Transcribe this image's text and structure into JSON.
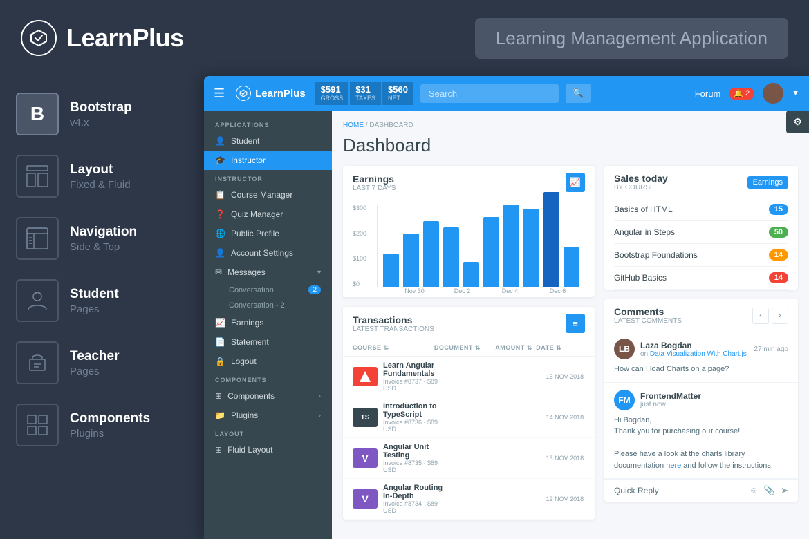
{
  "header": {
    "logo_text": "LearnPlus",
    "app_title": "Learning Management Application"
  },
  "left_sidebar": {
    "items": [
      {
        "id": "bootstrap",
        "main": "Bootstrap",
        "sub": "v4.x",
        "icon_type": "b"
      },
      {
        "id": "layout",
        "main": "Layout",
        "sub": "Fixed & Fluid",
        "icon_type": "layout"
      },
      {
        "id": "navigation",
        "main": "Navigation",
        "sub": "Side & Top",
        "icon_type": "nav"
      },
      {
        "id": "student",
        "main": "Student",
        "sub": "Pages",
        "icon_type": "student"
      },
      {
        "id": "teacher",
        "main": "Teacher",
        "sub": "Pages",
        "icon_type": "teacher"
      },
      {
        "id": "components",
        "main": "Components",
        "sub": "Plugins",
        "icon_type": "components"
      }
    ]
  },
  "inner_nav": {
    "logo": "LearnPlus",
    "stats": [
      {
        "value": "$591",
        "label": "GROSS"
      },
      {
        "value": "$31",
        "label": "TAXES"
      },
      {
        "value": "$560",
        "label": "NET"
      }
    ],
    "search_placeholder": "Search",
    "forum_label": "Forum",
    "notif_count": "2"
  },
  "inner_sidebar": {
    "sections": [
      {
        "label": "APPLICATIONS",
        "items": [
          {
            "label": "Student",
            "icon": "👤",
            "active": false
          },
          {
            "label": "Instructor",
            "icon": "🎓",
            "active": true
          }
        ]
      },
      {
        "label": "INSTRUCTOR",
        "items": [
          {
            "label": "Course Manager",
            "icon": "📋",
            "active": false
          },
          {
            "label": "Quiz Manager",
            "icon": "❓",
            "active": false
          },
          {
            "label": "Public Profile",
            "icon": "🌐",
            "active": false
          },
          {
            "label": "Account Settings",
            "icon": "👤",
            "active": false
          },
          {
            "label": "Messages",
            "icon": "✉",
            "active": false,
            "arrow": true
          },
          {
            "label": "Conversation",
            "sub": true,
            "badge": "2"
          },
          {
            "label": "Conversation - 2",
            "sub": true
          },
          {
            "label": "Earnings",
            "icon": "📈",
            "active": false
          },
          {
            "label": "Statement",
            "icon": "📄",
            "active": false
          },
          {
            "label": "Logout",
            "icon": "🔒",
            "active": false
          }
        ]
      },
      {
        "label": "COMPONENTS",
        "items": [
          {
            "label": "Components",
            "icon": "⊞",
            "active": false,
            "arrow": true
          },
          {
            "label": "Plugins",
            "icon": "📁",
            "active": false,
            "arrow": true
          }
        ]
      },
      {
        "label": "LAYOUT",
        "items": [
          {
            "label": "Fluid Layout",
            "icon": "⊞",
            "active": false
          }
        ]
      }
    ]
  },
  "dashboard": {
    "breadcrumb": {
      "home": "HOME",
      "current": "DASHBOARD"
    },
    "title": "Dashboard",
    "earnings_card": {
      "title": "Earnings",
      "subtitle": "LAST 7 DAYS",
      "y_labels": [
        "$300",
        "$200",
        "$100",
        "$0"
      ],
      "bars": [
        40,
        80,
        100,
        90,
        40,
        110,
        130,
        120,
        150,
        60
      ],
      "x_labels": [
        "Nov 30",
        "Dec 2",
        "Dec 4",
        "Dec 6"
      ]
    },
    "sales_card": {
      "title": "Sales today",
      "subtitle": "BY COURSE",
      "badge_label": "Earnings",
      "items": [
        {
          "name": "Basics of HTML",
          "count": "15",
          "color": "bg-blue"
        },
        {
          "name": "Angular in Steps",
          "count": "50",
          "color": "bg-green"
        },
        {
          "name": "Bootstrap Foundations",
          "count": "14",
          "color": "bg-orange"
        },
        {
          "name": "GitHub Basics",
          "count": "14",
          "color": "bg-red"
        }
      ]
    },
    "transactions_card": {
      "title": "Transactions",
      "subtitle": "LATEST TRANSACTIONS",
      "columns": [
        "COURSE",
        "DOCUMENT",
        "AMOUNT",
        "DATE"
      ],
      "rows": [
        {
          "title": "Learn Angular Fundamentals",
          "invoice": "Invoice #8737 - $89 USD",
          "amount": "",
          "date": "15 NOV 2018",
          "thumb_color": "#f44336",
          "thumb_text": "A"
        },
        {
          "title": "Introduction to TypeScript",
          "invoice": "Invoice #8736 - $89 USD",
          "amount": "",
          "date": "14 NOV 2018",
          "thumb_color": "#37474f",
          "thumb_text": "TS"
        },
        {
          "title": "Angular Unit Testing",
          "invoice": "Invoice #8735 - $89 USD",
          "amount": "",
          "date": "13 NOV 2018",
          "thumb_color": "#7e57c2",
          "thumb_text": "V"
        },
        {
          "title": "Angular Routing In-Depth",
          "invoice": "Invoice #8734 - $89 USD",
          "amount": "",
          "date": "12 NOV 2018",
          "thumb_color": "#7e57c2",
          "thumb_text": "V"
        }
      ]
    },
    "comments_card": {
      "title": "Comments",
      "subtitle": "LATEST COMMENTS",
      "comments": [
        {
          "author": "Laza Bogdan",
          "time": "27 min ago",
          "avatar_color": "#795548",
          "avatar_initials": "LB",
          "text_before": "on ",
          "link": "Data Visualization With Chart.js",
          "text_after": "",
          "body": "How can I load Charts on a page?"
        },
        {
          "author": "FrontendMatter",
          "time": "just now",
          "avatar_color": "#2196f3",
          "avatar_initials": "FM",
          "text_before": "",
          "link": "",
          "text_after": "",
          "body": "Hi Bogdan,\nThank you for purchasing our course!\n\nPlease have a look at the charts library documentation here and follow the instructions."
        }
      ],
      "quick_reply_label": "Quick Reply"
    }
  }
}
